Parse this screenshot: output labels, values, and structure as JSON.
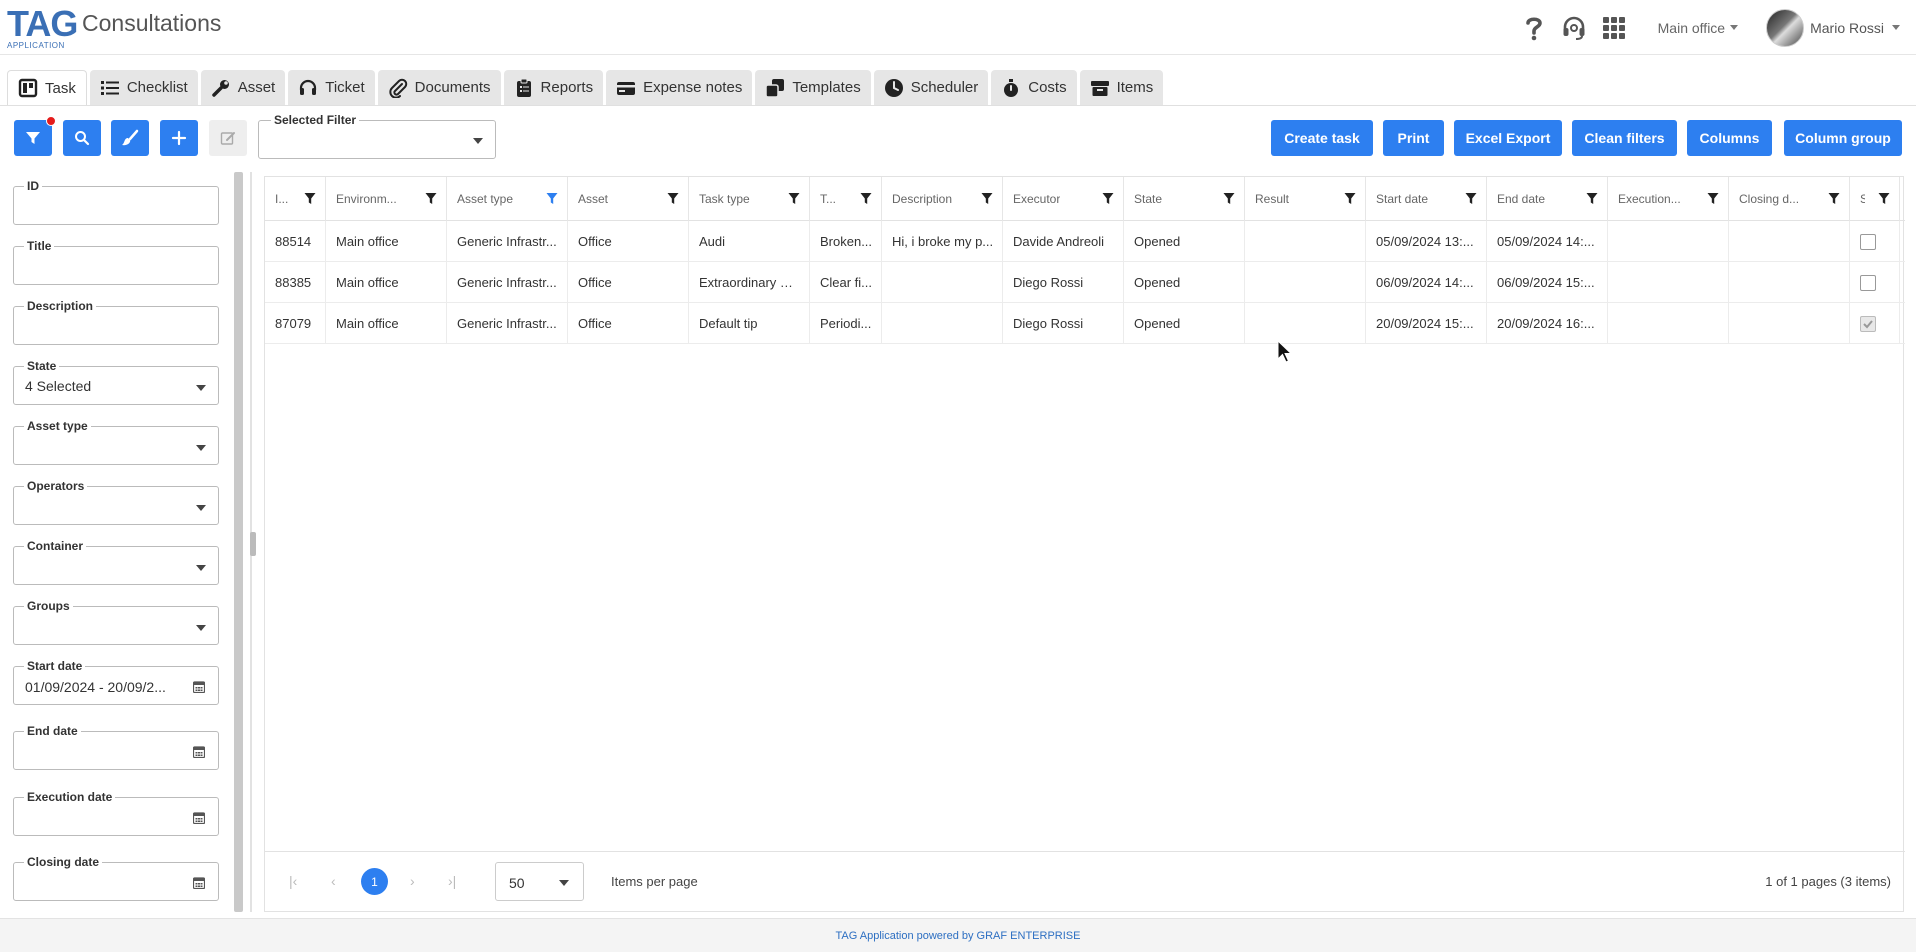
{
  "app": {
    "logo_big": "TAG",
    "logo_small": "APPLICATION",
    "page_title": "Consultations",
    "office": "Main office",
    "user_name": "Mario Rossi"
  },
  "tabs": [
    {
      "label": "Task",
      "icon": "kanban-icon",
      "active": true
    },
    {
      "label": "Checklist",
      "icon": "list-icon"
    },
    {
      "label": "Asset",
      "icon": "wrench-icon"
    },
    {
      "label": "Ticket",
      "icon": "headset-icon"
    },
    {
      "label": "Documents",
      "icon": "paperclip-icon"
    },
    {
      "label": "Reports",
      "icon": "clipboard-icon"
    },
    {
      "label": "Expense notes",
      "icon": "card-icon"
    },
    {
      "label": "Templates",
      "icon": "copy-icon"
    },
    {
      "label": "Scheduler",
      "icon": "clock-icon"
    },
    {
      "label": "Costs",
      "icon": "stopwatch-icon"
    },
    {
      "label": "Items",
      "icon": "box-icon"
    }
  ],
  "toolbar": {
    "selected_filter_label": "Selected Filter",
    "selected_filter_value": "",
    "create_task": "Create task",
    "print": "Print",
    "excel_export": "Excel Export",
    "clean_filters": "Clean filters",
    "columns": "Columns",
    "column_group": "Column group"
  },
  "filters": [
    {
      "label": "ID",
      "value": "",
      "kind": "text"
    },
    {
      "label": "Title",
      "value": "",
      "kind": "text"
    },
    {
      "label": "Description",
      "value": "",
      "kind": "text"
    },
    {
      "label": "State",
      "value": "4 Selected",
      "kind": "select"
    },
    {
      "label": "Asset type",
      "value": "",
      "kind": "select"
    },
    {
      "label": "Operators",
      "value": "",
      "kind": "select"
    },
    {
      "label": "Container",
      "value": "",
      "kind": "select"
    },
    {
      "label": "Groups",
      "value": "",
      "kind": "select"
    },
    {
      "label": "Start date",
      "value": "01/09/2024 - 20/09/2...",
      "kind": "date"
    },
    {
      "label": "End date",
      "value": "",
      "kind": "date"
    },
    {
      "label": "Execution date",
      "value": "",
      "kind": "date"
    },
    {
      "label": "Closing date",
      "value": "",
      "kind": "date"
    }
  ],
  "grid": {
    "columns": [
      "I...",
      "Environm...",
      "Asset type",
      "Asset",
      "Task type",
      "T...",
      "Description",
      "Executor",
      "State",
      "Result",
      "Start date",
      "End date",
      "Execution...",
      "Closing d...",
      "S..."
    ],
    "active_filter_column": 2,
    "rows": [
      [
        "88514",
        "Main office",
        "Generic Infrastr...",
        "Office",
        "Audi",
        "Broken...",
        "Hi, i broke my p...",
        "Davide Andreoli",
        "Opened",
        "",
        "05/09/2024 13:...",
        "05/09/2024 14:...",
        "",
        ""
      ],
      [
        "88385",
        "Main office",
        "Generic Infrastr...",
        "Office",
        "Extraordinary M...",
        "Clear fi...",
        "",
        "Diego Rossi",
        "Opened",
        "",
        "06/09/2024 14:...",
        "06/09/2024 15:...",
        "",
        ""
      ],
      [
        "87079",
        "Main office",
        "Generic Infrastr...",
        "Office",
        "Default tip",
        "Periodi...",
        "",
        "Diego Rossi",
        "Opened",
        "",
        "20/09/2024 15:...",
        "20/09/2024 16:...",
        "",
        ""
      ]
    ],
    "checked": [
      false,
      false,
      true
    ]
  },
  "pager": {
    "current_page": "1",
    "page_size": "50",
    "items_per_page_label": "Items per page",
    "info": "1 of 1 pages (3 items)"
  },
  "footer": {
    "text": "TAG Application powered by GRAF ENTERPRISE"
  },
  "colors": {
    "accent": "#2d7ff0",
    "logo": "#3a6fb5",
    "badge": "#e51c1c"
  }
}
